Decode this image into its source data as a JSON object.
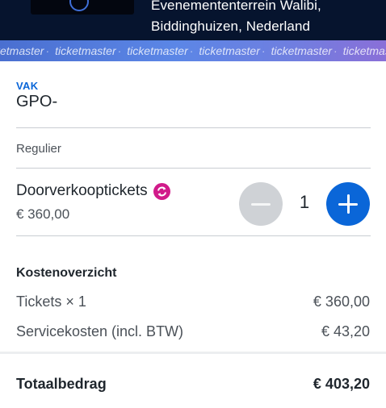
{
  "event": {
    "venue_line1": "Evenemententerrein Walibi,",
    "venue_line2": "Biddinghuizen, Nederland"
  },
  "brand_band": {
    "text": "ticketmaster",
    "repeat": 6
  },
  "section": {
    "label": "VAK",
    "value": "GPO-"
  },
  "category": "Regulier",
  "ticket": {
    "name": "Doorverkooptickets",
    "price": "€ 360,00",
    "quantity": "1",
    "resale_icon": "resale-cycle-icon"
  },
  "summary": {
    "title": "Kostenoverzicht",
    "rows": [
      {
        "label": "Tickets × 1",
        "value": "€ 360,00"
      },
      {
        "label": "Servicekosten (incl. BTW)",
        "value": "€ 43,20"
      }
    ]
  },
  "total": {
    "label": "Totaalbedrag",
    "value": "€ 403,20"
  },
  "colors": {
    "accent": "#0a66d8",
    "resale": "#d11b8a",
    "header_bg": "#06142e"
  }
}
